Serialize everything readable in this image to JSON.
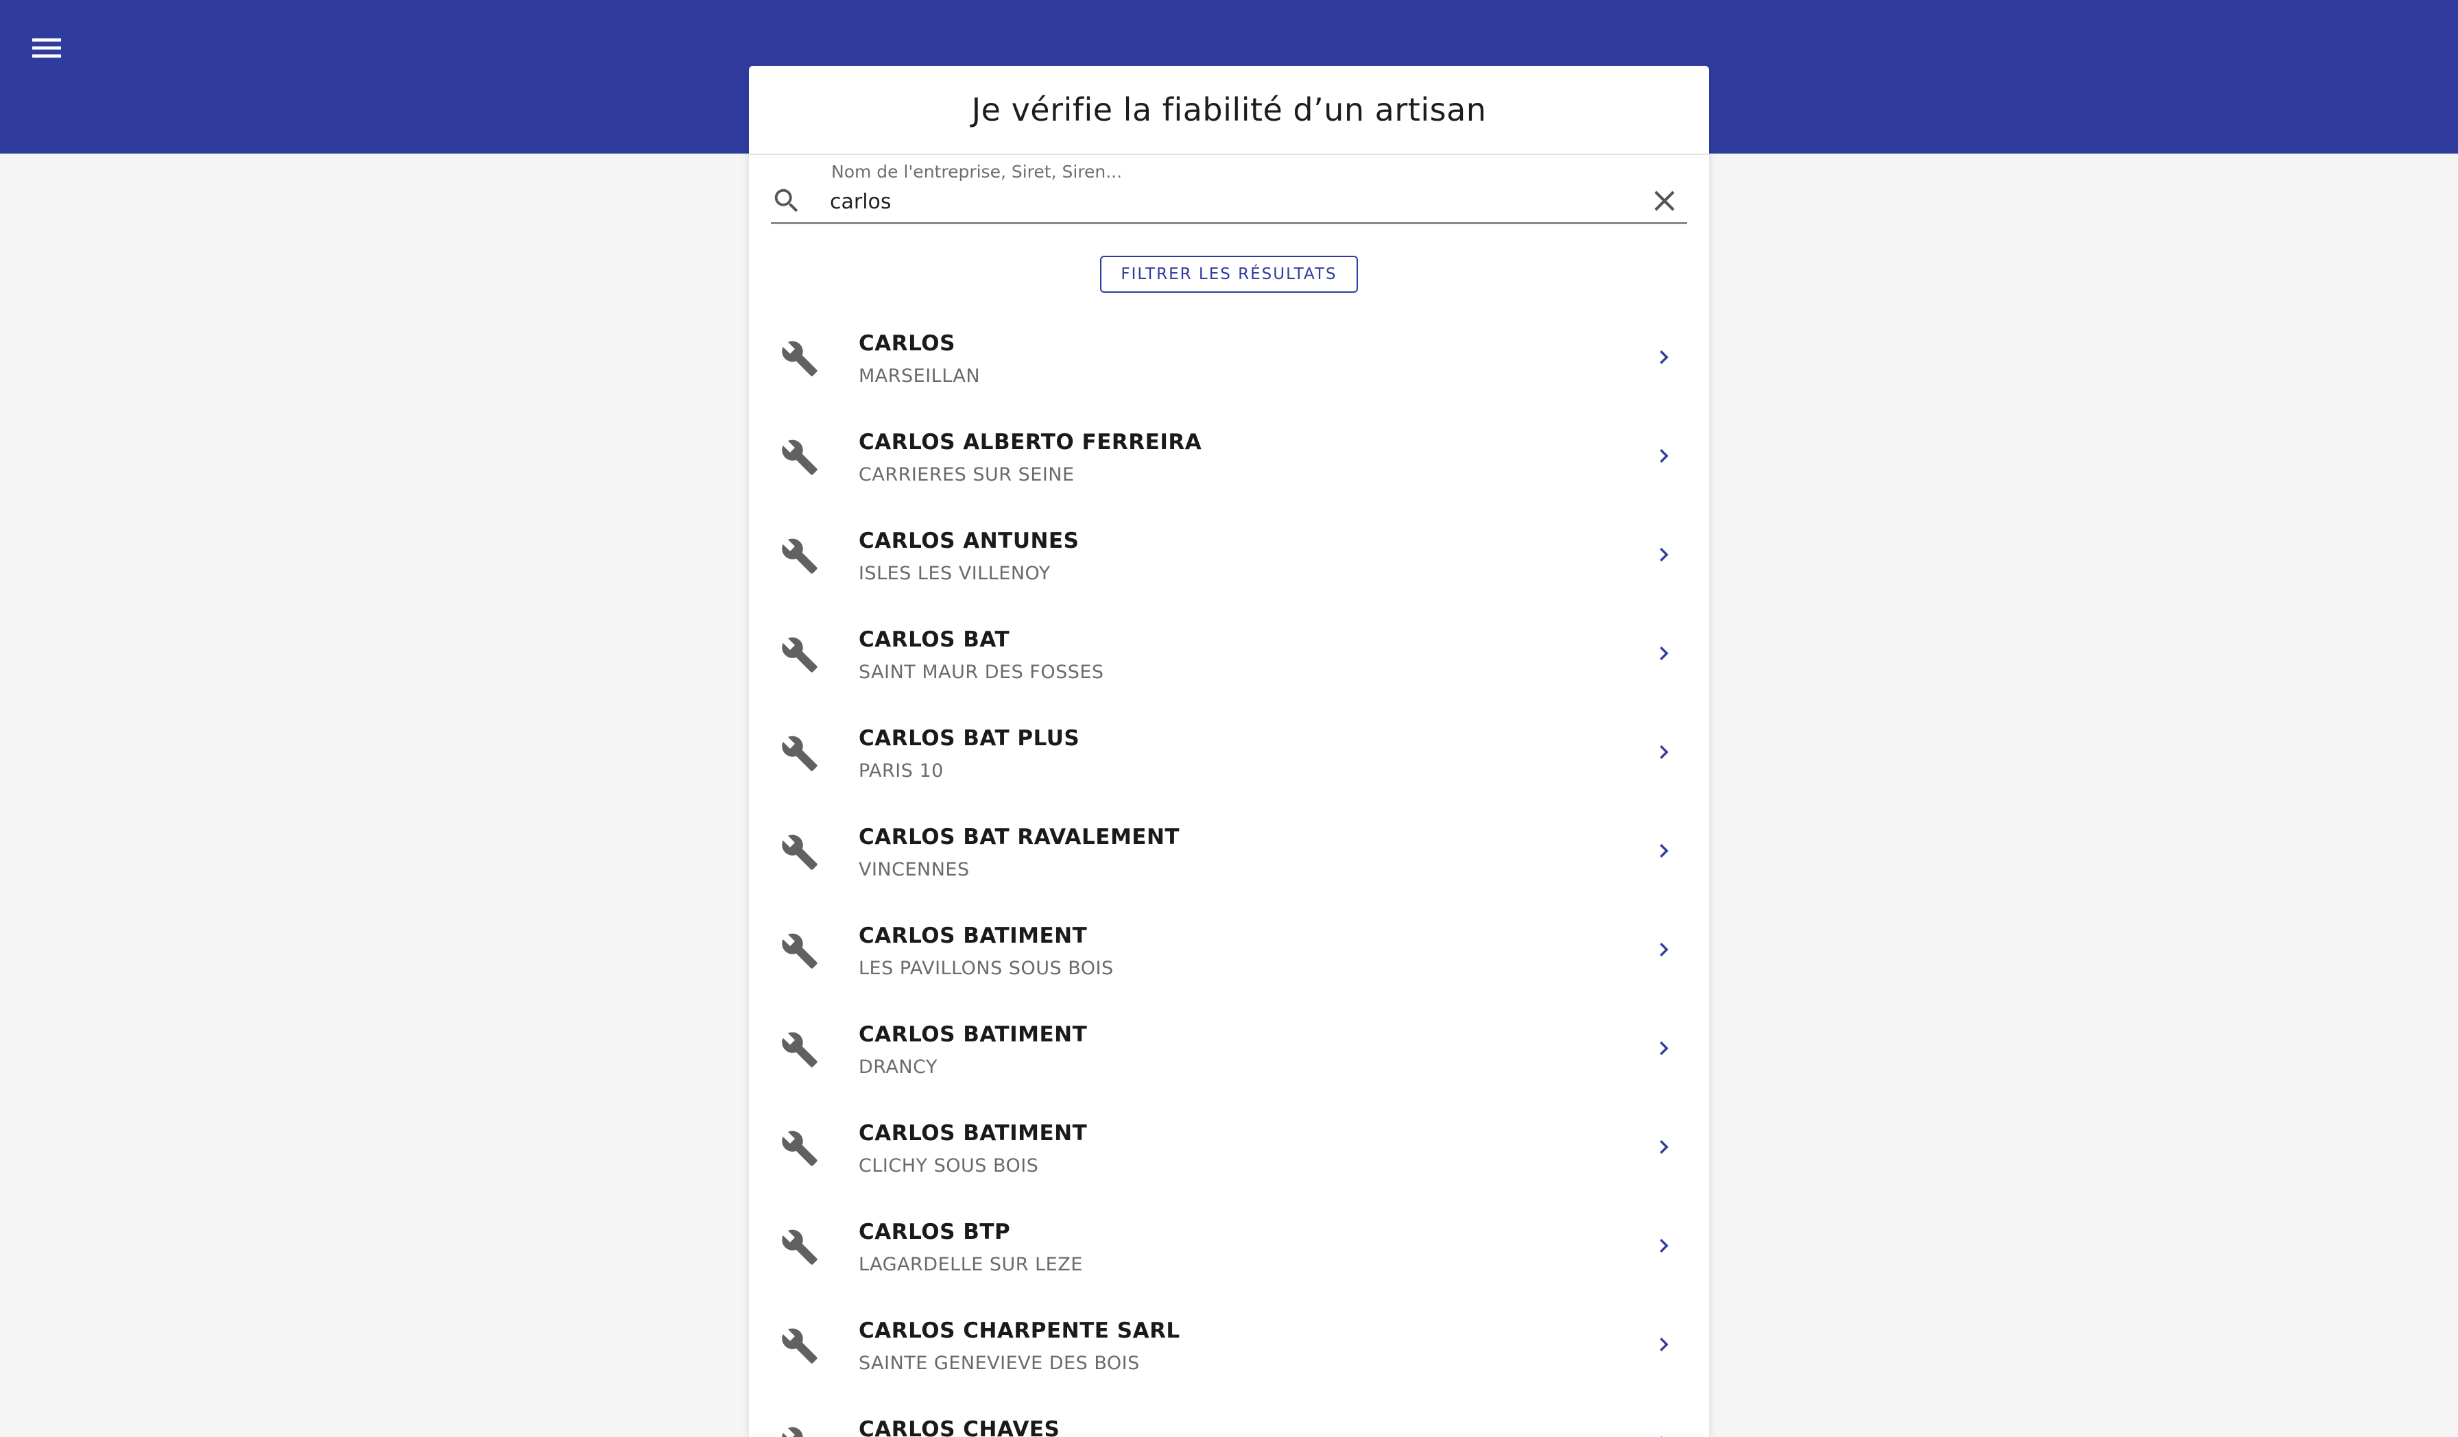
{
  "header": {
    "menu_icon": "hamburger-menu-icon",
    "color": "#2f3c9e"
  },
  "card": {
    "title": "Je vérifie la fiabilité d’un artisan"
  },
  "search": {
    "label": "Nom de l'entreprise, Siret, Siren...",
    "value": "carlos",
    "icon": "search-icon",
    "clear_icon": "close-icon"
  },
  "filter": {
    "label": "FILTRER LES RÉSULTATS"
  },
  "results": [
    {
      "name": "CARLOS",
      "city": "MARSEILLAN"
    },
    {
      "name": "CARLOS ALBERTO FERREIRA",
      "city": "CARRIERES SUR SEINE"
    },
    {
      "name": "CARLOS ANTUNES",
      "city": "ISLES LES VILLENOY"
    },
    {
      "name": "CARLOS BAT",
      "city": "SAINT MAUR DES FOSSES"
    },
    {
      "name": "CARLOS BAT PLUS",
      "city": "PARIS 10"
    },
    {
      "name": "CARLOS BAT RAVALEMENT",
      "city": "VINCENNES"
    },
    {
      "name": "CARLOS BATIMENT",
      "city": "LES PAVILLONS SOUS BOIS"
    },
    {
      "name": "CARLOS BATIMENT",
      "city": "DRANCY"
    },
    {
      "name": "CARLOS BATIMENT",
      "city": "CLICHY SOUS BOIS"
    },
    {
      "name": "CARLOS BTP",
      "city": "LAGARDELLE SUR LEZE"
    },
    {
      "name": "CARLOS CHARPENTE SARL",
      "city": "SAINTE GENEVIEVE DES BOIS"
    },
    {
      "name": "CARLOS CHAVES",
      "city": ""
    }
  ],
  "icons": {
    "row_icon": "wrench-icon",
    "row_chevron": "chevron-right-icon"
  },
  "colors": {
    "primary": "#2f3c9e",
    "background": "#f5f5f5"
  }
}
